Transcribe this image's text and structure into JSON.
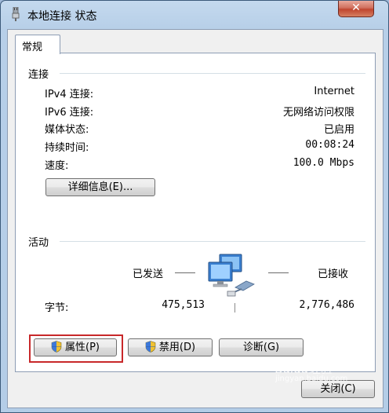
{
  "window": {
    "title": "本地连接 状态",
    "close_symbol": "✕"
  },
  "tabs": [
    {
      "label": "常规",
      "selected": true
    }
  ],
  "connection": {
    "heading": "连接",
    "rows": [
      {
        "label": "IPv4 连接:",
        "value": "Internet"
      },
      {
        "label": "IPv6 连接:",
        "value": "无网络访问权限"
      },
      {
        "label": "媒体状态:",
        "value": "已启用"
      },
      {
        "label": "持续时间:",
        "value": "00:08:24"
      },
      {
        "label": "速度:",
        "value": "100.0 Mbps"
      }
    ],
    "details_button": "详细信息(E)..."
  },
  "activity": {
    "heading": "活动",
    "sent_label": "已发送",
    "received_label": "已接收",
    "bytes_label": "字节:",
    "bytes_sent": "475,513",
    "bytes_received": "2,776,486"
  },
  "buttons": {
    "properties": "属性(P)",
    "disable": "禁用(D)",
    "diagnose": "诊断(G)",
    "close": "关闭(C)"
  },
  "watermark": {
    "text": "Baidu经验",
    "subtext": "jingyan.baidu.com"
  },
  "colors": {
    "window_frame": "#b4cde7",
    "close_button": "#c0462f",
    "highlight_box": "#c8282a",
    "panel": "#f0f0f0"
  },
  "icons": [
    "title-network-icon",
    "network-computers-icon",
    "uac-shield-icon"
  ]
}
